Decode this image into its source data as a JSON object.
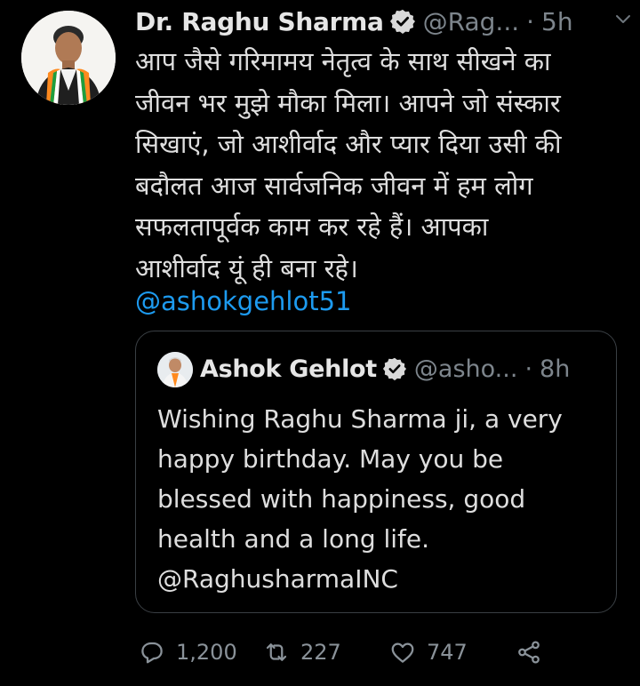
{
  "tweet": {
    "author_name": "Dr. Raghu Sharma",
    "handle": "@Rag...",
    "separator": "·",
    "time": "5h",
    "body": "आप जैसे गरिमामय नेतृत्व के साथ सीखने का\nजीवन भर मुझे मौका मिला। आपने जो संस्कार\nसिखाएं, जो आशीर्वाद और प्यार दिया उसी की\nबदौलत आज सार्वजनिक जीवन में हम लोग\nसफलतापूर्वक काम कर रहे हैं। आपका\nआशीर्वाद यूं ही बना रहे।",
    "mention": "@ashokgehlot51"
  },
  "quoted_tweet": {
    "author_name": "Ashok Gehlot",
    "handle": "@asho...",
    "separator": "·",
    "time": "8h",
    "body": "Wishing Raghu Sharma ji, a very\nhappy birthday. May you be\nblessed with happiness, good\nhealth and a long life.\n@RaghusharmaINC"
  },
  "actions": {
    "reply_count": "1,200",
    "retweet_count": "227",
    "like_count": "747"
  },
  "icons": {
    "verified": "verified-badge-icon",
    "caret": "chevron-down-icon",
    "reply": "reply-icon",
    "retweet": "retweet-icon",
    "like": "heart-icon",
    "share": "share-icon"
  },
  "colors": {
    "background": "#000000",
    "link": "#1d9bf0",
    "muted": "#7d858c",
    "quote_border": "#3a3f44"
  }
}
